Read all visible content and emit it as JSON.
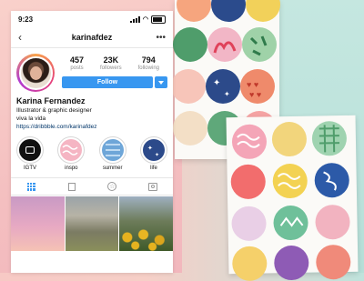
{
  "status_bar": {
    "time": "9:23"
  },
  "header": {
    "username": "karinafdez",
    "back_icon": "chevron-left-icon",
    "more_icon": "ellipsis-icon"
  },
  "stats": [
    {
      "value": "457",
      "label": "posts"
    },
    {
      "value": "23K",
      "label": "followers"
    },
    {
      "value": "794",
      "label": "following"
    }
  ],
  "follow": {
    "label": "Follow",
    "color": "#3897f0"
  },
  "bio": {
    "name": "Karina Fernandez",
    "line1": "Illustrator & graphic designer",
    "line2": "viva la vida",
    "link": "https://dribbble.com/karinafdez"
  },
  "highlights": [
    {
      "label": "IGTV"
    },
    {
      "label": "inspo"
    },
    {
      "label": "summer"
    },
    {
      "label": "life"
    }
  ],
  "tabs": [
    "grid-icon",
    "feed-icon",
    "star-icon",
    "tag-icon"
  ]
}
